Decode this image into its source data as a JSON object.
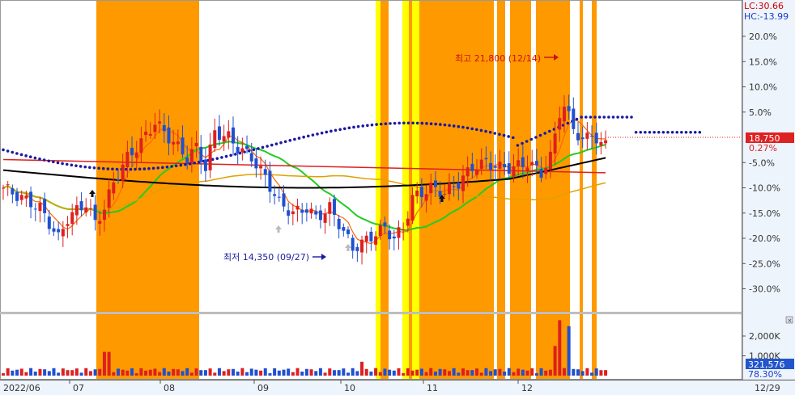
{
  "chart_data": {
    "type": "candlestick",
    "price_panel": {
      "y_axis_ticks": [
        "20.0%",
        "15.0%",
        "10.0%",
        "5.0%",
        "-5.0%",
        "-10.0%",
        "-15.0%",
        "-20.0%",
        "-25.0%",
        "-30.0%"
      ],
      "y_axis_tick_values": [
        20,
        15,
        10,
        5,
        -5,
        -10,
        -15,
        -20,
        -25,
        -30
      ],
      "lc_label": "LC:30.66",
      "hc_label": "HC:-13.99",
      "current_price_label": "18,750",
      "current_change_label": "0.27%",
      "max_annotation": "최고 21,800 (12/14)",
      "min_annotation": "최저 14,350 (09/27)"
    },
    "volume_panel": {
      "y_axis_ticks": [
        "2,000K",
        "1,000K"
      ],
      "y_axis_tick_values": [
        2000,
        1000
      ],
      "current_volume_label": "321,576",
      "current_volume_pct_label": "78.30%"
    },
    "x_axis_labels": [
      "2022/06",
      "07",
      "08",
      "09",
      "10",
      "11",
      "12",
      "12/29"
    ],
    "x_axis_label_dates": [
      "2022-06",
      "2022-07",
      "2022-08",
      "2022-09",
      "2022-10",
      "2022-11",
      "2022-12",
      "2022-12-29"
    ],
    "highlight_colors": {
      "orange": "#ff9900",
      "yellow": "#ffff00"
    },
    "series_colors": {
      "ma_short": "#ff6600",
      "ma_mid": "#22cc22",
      "ma_long": "#e0a000",
      "ma_year": "#000000",
      "ma_red": "#dd2020",
      "dots": "#1a1aa0",
      "candle_up": "#dd2020",
      "candle_down": "#2050d0"
    },
    "candle_count": 132
  }
}
